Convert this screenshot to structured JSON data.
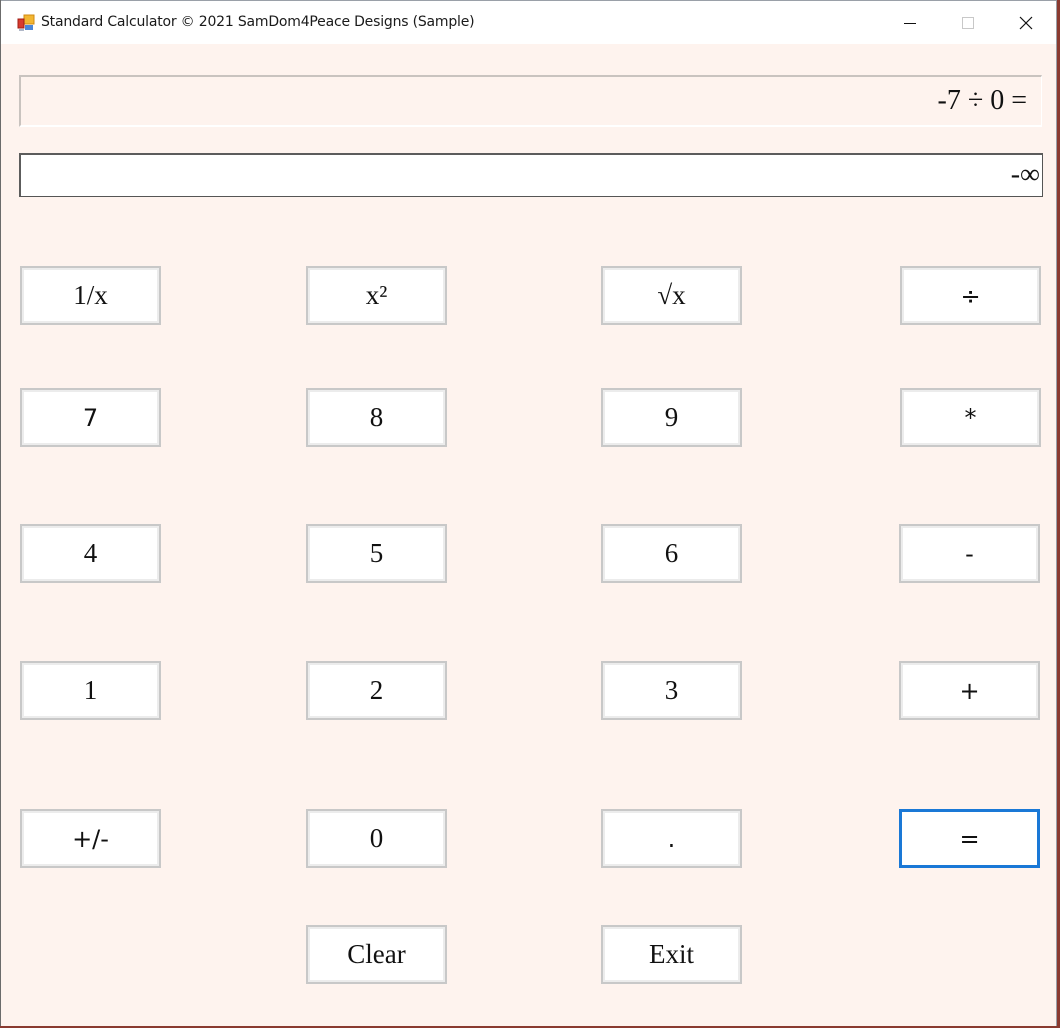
{
  "window": {
    "title": "Standard Calculator © 2021 SamDom4Peace Designs (Sample)",
    "icon": "app-window-icon",
    "controls": {
      "minimize_icon": "minimize-icon",
      "maximize_icon": "maximize-icon",
      "close_icon": "close-icon"
    }
  },
  "display": {
    "expression": "-7 ÷ 0 =",
    "result": "-∞"
  },
  "buttons": {
    "reciprocal": "1/x",
    "square": "x²",
    "sqrt": "√x",
    "divide": "÷",
    "seven": "7",
    "eight": "8",
    "nine": "9",
    "multiply": "*",
    "four": "4",
    "five": "5",
    "six": "6",
    "subtract": "-",
    "one": "1",
    "two": "2",
    "three": "3",
    "add": "+",
    "negate": "+/-",
    "zero": "0",
    "decimal": ".",
    "equals": "=",
    "clear": "Clear",
    "exit": "Exit"
  },
  "colors": {
    "background": "#fef3ee",
    "focus_border": "#1a78d6",
    "button_border": "#c8c8c8"
  }
}
